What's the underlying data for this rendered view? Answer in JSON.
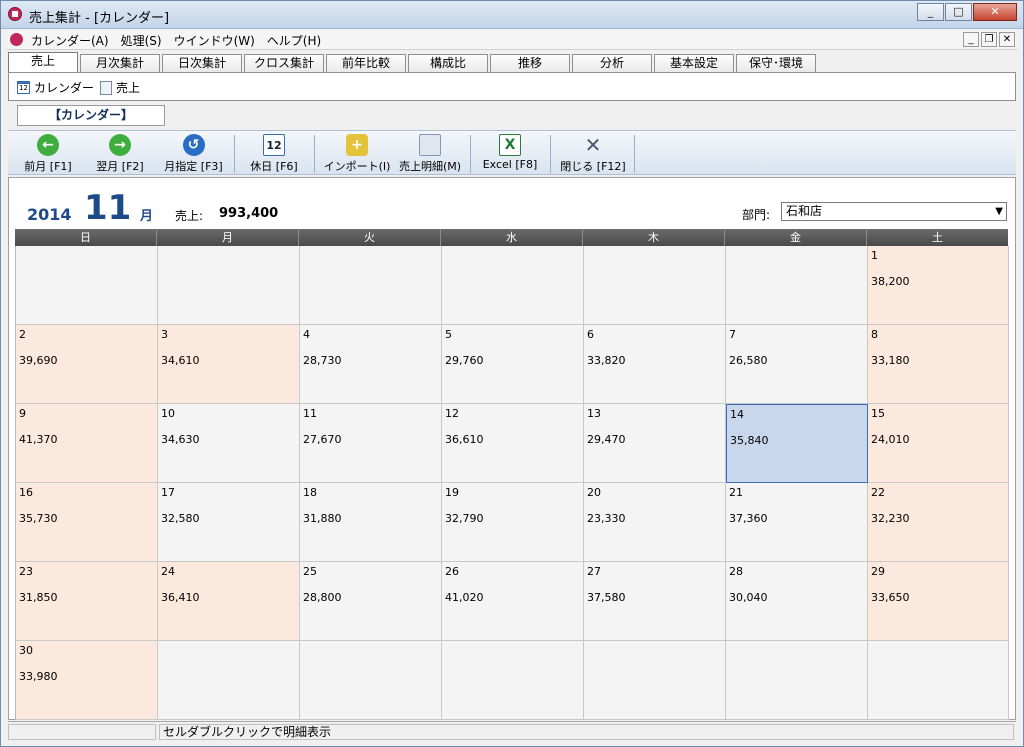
{
  "window": {
    "title": "売上集計 - [カレンダー]"
  },
  "menu": [
    "カレンダー(A)",
    "処理(S)",
    "ウインドウ(W)",
    "ヘルプ(H)"
  ],
  "tabs": [
    "売上",
    "月次集計",
    "日次集計",
    "クロス集計",
    "前年比較",
    "構成比",
    "推移",
    "分析",
    "基本設定",
    "保守･環境"
  ],
  "subtabs": {
    "calendar": "カレンダー",
    "sales": "売上"
  },
  "section_label": "【カレンダー】",
  "toolbar": {
    "prev": "前月 [F1]",
    "next": "翌月 [F2]",
    "month": "月指定 [F3]",
    "holiday": "休日 [F6]",
    "import": "インポート(I)",
    "detail": "売上明細(M)",
    "excel": "Excel [F8]",
    "close": "閉じる [F12]"
  },
  "header": {
    "year": "2014",
    "month": "11",
    "month_unit": "月",
    "sales_label": "売上:",
    "sales_total": "993,400",
    "dept_label": "部門:",
    "dept_value": "石和店"
  },
  "weekdays": [
    "日",
    "月",
    "火",
    "水",
    "木",
    "金",
    "土"
  ],
  "status": "セルダブルクリックで明細表示",
  "days": [
    {
      "d": "",
      "v": ""
    },
    {
      "d": "",
      "v": ""
    },
    {
      "d": "",
      "v": ""
    },
    {
      "d": "",
      "v": ""
    },
    {
      "d": "",
      "v": ""
    },
    {
      "d": "",
      "v": ""
    },
    {
      "d": "1",
      "v": "38,200"
    },
    {
      "d": "2",
      "v": "39,690"
    },
    {
      "d": "3",
      "v": "34,610"
    },
    {
      "d": "4",
      "v": "28,730"
    },
    {
      "d": "5",
      "v": "29,760"
    },
    {
      "d": "6",
      "v": "33,820"
    },
    {
      "d": "7",
      "v": "26,580"
    },
    {
      "d": "8",
      "v": "33,180"
    },
    {
      "d": "9",
      "v": "41,370"
    },
    {
      "d": "10",
      "v": "34,630"
    },
    {
      "d": "11",
      "v": "27,670"
    },
    {
      "d": "12",
      "v": "36,610"
    },
    {
      "d": "13",
      "v": "29,470"
    },
    {
      "d": "14",
      "v": "35,840"
    },
    {
      "d": "15",
      "v": "24,010"
    },
    {
      "d": "16",
      "v": "35,730"
    },
    {
      "d": "17",
      "v": "32,580"
    },
    {
      "d": "18",
      "v": "31,880"
    },
    {
      "d": "19",
      "v": "32,790"
    },
    {
      "d": "20",
      "v": "23,330"
    },
    {
      "d": "21",
      "v": "37,360"
    },
    {
      "d": "22",
      "v": "32,230"
    },
    {
      "d": "23",
      "v": "31,850"
    },
    {
      "d": "24",
      "v": "36,410"
    },
    {
      "d": "25",
      "v": "28,800"
    },
    {
      "d": "26",
      "v": "41,020"
    },
    {
      "d": "27",
      "v": "37,580"
    },
    {
      "d": "28",
      "v": "30,040"
    },
    {
      "d": "29",
      "v": "33,650"
    },
    {
      "d": "30",
      "v": "33,980"
    },
    {
      "d": "",
      "v": ""
    },
    {
      "d": "",
      "v": ""
    },
    {
      "d": "",
      "v": ""
    },
    {
      "d": "",
      "v": ""
    },
    {
      "d": "",
      "v": ""
    },
    {
      "d": "",
      "v": ""
    }
  ],
  "highlighted_days": [
    "3",
    "24"
  ],
  "selected_day": "14"
}
